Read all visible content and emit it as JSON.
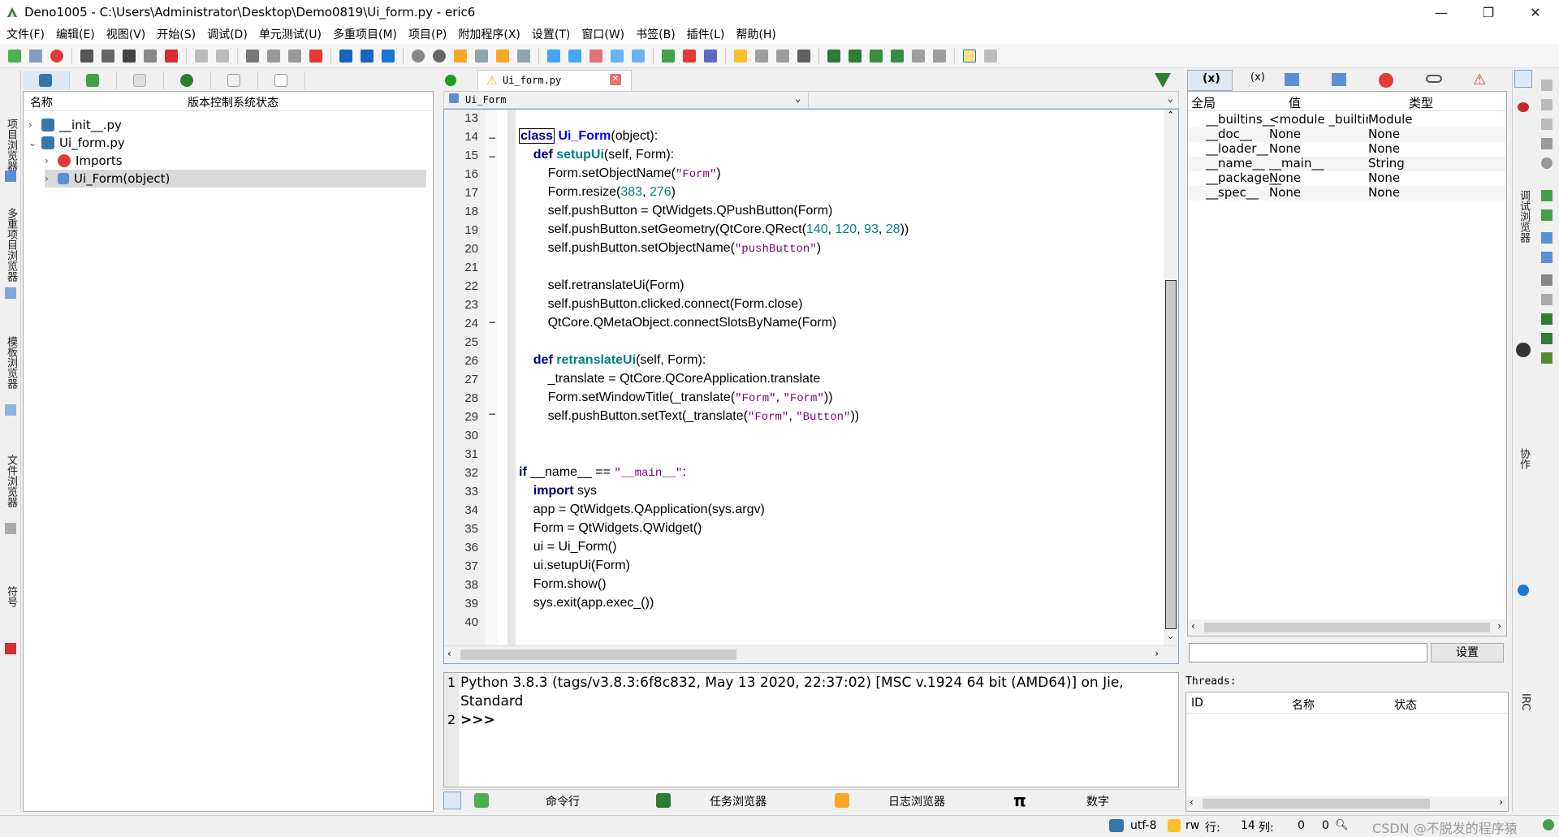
{
  "window": {
    "title": "Deno1005 - C:\\Users\\Administrator\\Desktop\\Demo0819\\Ui_form.py - eric6",
    "minimize": "—",
    "maximize": "❐",
    "close": "✕"
  },
  "menu": [
    "文件(F)",
    "编辑(E)",
    "视图(V)",
    "开始(S)",
    "调试(D)",
    "单元测试(U)",
    "多重项目(M)",
    "项目(P)",
    "附加程序(X)",
    "设置(T)",
    "窗口(W)",
    "书签(B)",
    "插件(L)",
    "帮助(H)"
  ],
  "left_vtabs": [
    "项目浏览器",
    "多重项目浏览器",
    "模板浏览器",
    "文件浏览器",
    "符号"
  ],
  "project": {
    "col_name": "名称",
    "col_vcs": "版本控制系统状态",
    "rows": [
      {
        "label": "__init__.py"
      },
      {
        "label": "Ui_form.py"
      },
      {
        "label": "Imports"
      },
      {
        "label": "Ui_Form(object)"
      }
    ]
  },
  "editor": {
    "tab_label": "Ui_form.py",
    "tab_close": "✕",
    "class_combo": "Ui_Form",
    "line_numbers": [
      "13",
      "14",
      "15",
      "16",
      "17",
      "18",
      "19",
      "20",
      "21",
      "22",
      "23",
      "24",
      "25",
      "26",
      "27",
      "28",
      "29",
      "30",
      "31",
      "32",
      "33",
      "34",
      "35",
      "36",
      "37",
      "38",
      "39",
      "40"
    ]
  },
  "shell": {
    "line1_no": "1",
    "line2_no": "2",
    "line1a": "Python 3.8.3 (tags/v3.8.3:6f8c832, May 13 2020, 22:37:02) [MSC v.1924 64 bit (AMD64)] on Jie,",
    "line1b": "Standard",
    "prompt": ">>>"
  },
  "bottom_tabs": [
    "命令行",
    "任务浏览器",
    "日志浏览器",
    "数字"
  ],
  "variables": {
    "col_name": "全局",
    "col_value": "值",
    "col_type": "类型",
    "rows": [
      {
        "name": "__builtins__",
        "value": "<module _builtin...",
        "type": "Module"
      },
      {
        "name": "__doc__",
        "value": "None",
        "type": "None"
      },
      {
        "name": "__loader__",
        "value": "None",
        "type": "None"
      },
      {
        "name": "__name__",
        "value": "__main__",
        "type": "String"
      },
      {
        "name": "__package__",
        "value": "None",
        "type": "None"
      },
      {
        "name": "__spec__",
        "value": "None",
        "type": "None"
      }
    ],
    "filter_button": "设置"
  },
  "threads": {
    "label": "Threads:",
    "col_id": "ID",
    "col_name": "名称",
    "col_state": "状态"
  },
  "right_vtabs": [
    "调试浏览器",
    "协作",
    "IRC"
  ],
  "status": {
    "encoding": "utf-8",
    "mode": "rw",
    "line_label": "行:",
    "line_value": "14",
    "col_label": "列:",
    "col_value": "0",
    "zoom": "0",
    "watermark": "CSDN @不脱发的程序猿"
  }
}
